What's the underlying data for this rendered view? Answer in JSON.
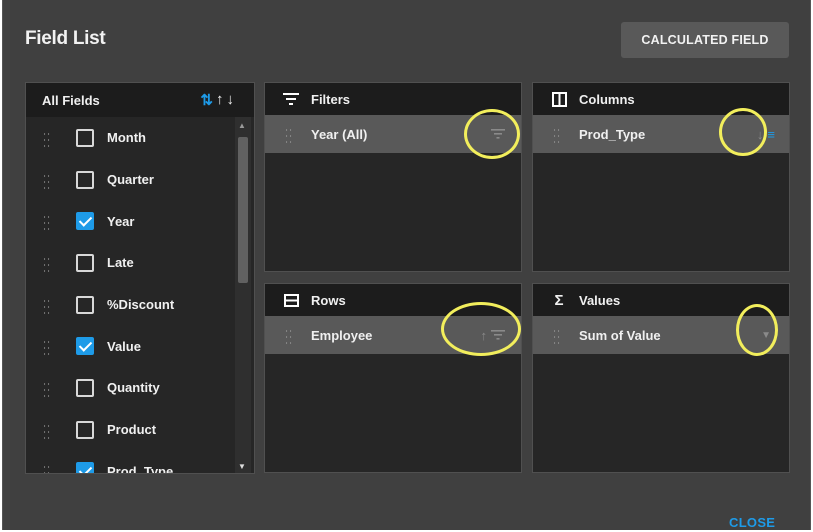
{
  "dialog": {
    "title": "Field List",
    "calculated_field_label": "CALCULATED FIELD",
    "close_label": "CLOSE"
  },
  "all_fields": {
    "header": "All Fields",
    "sort_icons": [
      "sort-toggle-icon",
      "arrow-up-icon",
      "arrow-down-icon"
    ],
    "items": [
      {
        "label": "Month",
        "checked": false
      },
      {
        "label": "Quarter",
        "checked": false
      },
      {
        "label": "Year",
        "checked": true
      },
      {
        "label": "Late",
        "checked": false
      },
      {
        "label": "%Discount",
        "checked": false
      },
      {
        "label": "Value",
        "checked": true
      },
      {
        "label": "Quantity",
        "checked": false
      },
      {
        "label": "Product",
        "checked": false
      },
      {
        "label": "Prod_Type",
        "checked": true
      }
    ]
  },
  "areas": {
    "filters": {
      "title": "Filters",
      "icon": "filter-icon",
      "items": [
        {
          "label": "Year (All)",
          "icon": "filter-icon"
        }
      ]
    },
    "columns": {
      "title": "Columns",
      "icon": "columns-icon",
      "items": [
        {
          "label": "Prod_Type",
          "icon": "sort-down-icon"
        }
      ]
    },
    "rows": {
      "title": "Rows",
      "icon": "rows-icon",
      "items": [
        {
          "label": "Employee",
          "icon": "sort-up-icon"
        }
      ]
    },
    "values": {
      "title": "Values",
      "icon": "sigma-icon",
      "items": [
        {
          "label": "Sum of Value",
          "icon": "dropdown-icon"
        }
      ]
    }
  },
  "colors": {
    "accent": "#1e9be8",
    "background": "#404040",
    "panel": "#262626",
    "highlight": "#f2ee5c"
  }
}
